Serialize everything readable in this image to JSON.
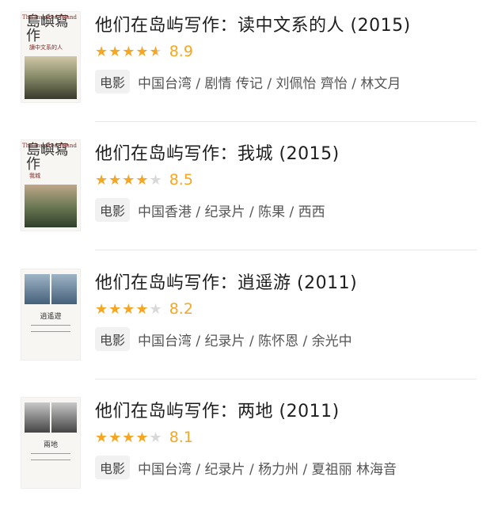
{
  "colors": {
    "accent_star": "#f5a623",
    "empty_star": "#d9d9d9"
  },
  "items": [
    {
      "title": "他们在岛屿写作：读中文系的人 (2015)",
      "stars": {
        "full": 4,
        "half": 1,
        "empty": 0
      },
      "score": "8.9",
      "category": "电影",
      "meta": "中国台湾 / 剧情 传记 / 刘佩怡 齊怡 / 林文月",
      "poster": {
        "calligraphy": "島嶼寫作",
        "small": "The Inspired Island",
        "subtitle": "讀中文系的人"
      }
    },
    {
      "title": "他们在岛屿写作：我城 (2015)",
      "stars": {
        "full": 4,
        "half": 0,
        "empty": 1
      },
      "score": "8.5",
      "category": "电影",
      "meta": "中国香港 / 纪录片 / 陈果 / 西西",
      "poster": {
        "calligraphy": "島嶼寫作",
        "small": "The Inspired Island",
        "subtitle": "我城"
      }
    },
    {
      "title": "他们在岛屿写作：逍遥游 (2011)",
      "stars": {
        "full": 4,
        "half": 0,
        "empty": 1
      },
      "score": "8.2",
      "category": "电影",
      "meta": "中国台湾 / 纪录片 / 陈怀恩 / 余光中",
      "poster": {
        "subtitle": "逍遙遊"
      }
    },
    {
      "title": "他们在岛屿写作：两地 (2011)",
      "stars": {
        "full": 4,
        "half": 0,
        "empty": 1
      },
      "score": "8.1",
      "category": "电影",
      "meta": "中国台湾 / 纪录片 / 杨力州 / 夏祖丽 林海音",
      "poster": {
        "subtitle": "兩地"
      }
    }
  ]
}
